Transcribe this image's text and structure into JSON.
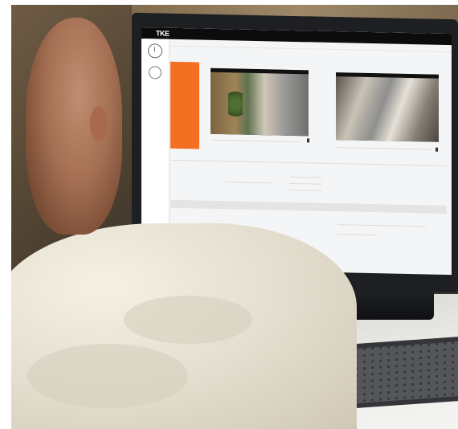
{
  "scene": {
    "description_colors": {
      "accent_orange": "#f36f21",
      "screen_bg": "#f4f5f6",
      "shirt": "#ece6d8"
    }
  },
  "screen": {
    "logo": "TKE",
    "sidebar": {
      "item1_label": "",
      "item2_icon": "user-icon"
    },
    "panel_title": "",
    "columns": {
      "state": "",
      "camera1": "",
      "camera2": ""
    },
    "orange_tile_text": "",
    "section_title": "",
    "labels": {
      "a": "",
      "b": "",
      "c": "",
      "d": ""
    },
    "bar_title": ""
  }
}
